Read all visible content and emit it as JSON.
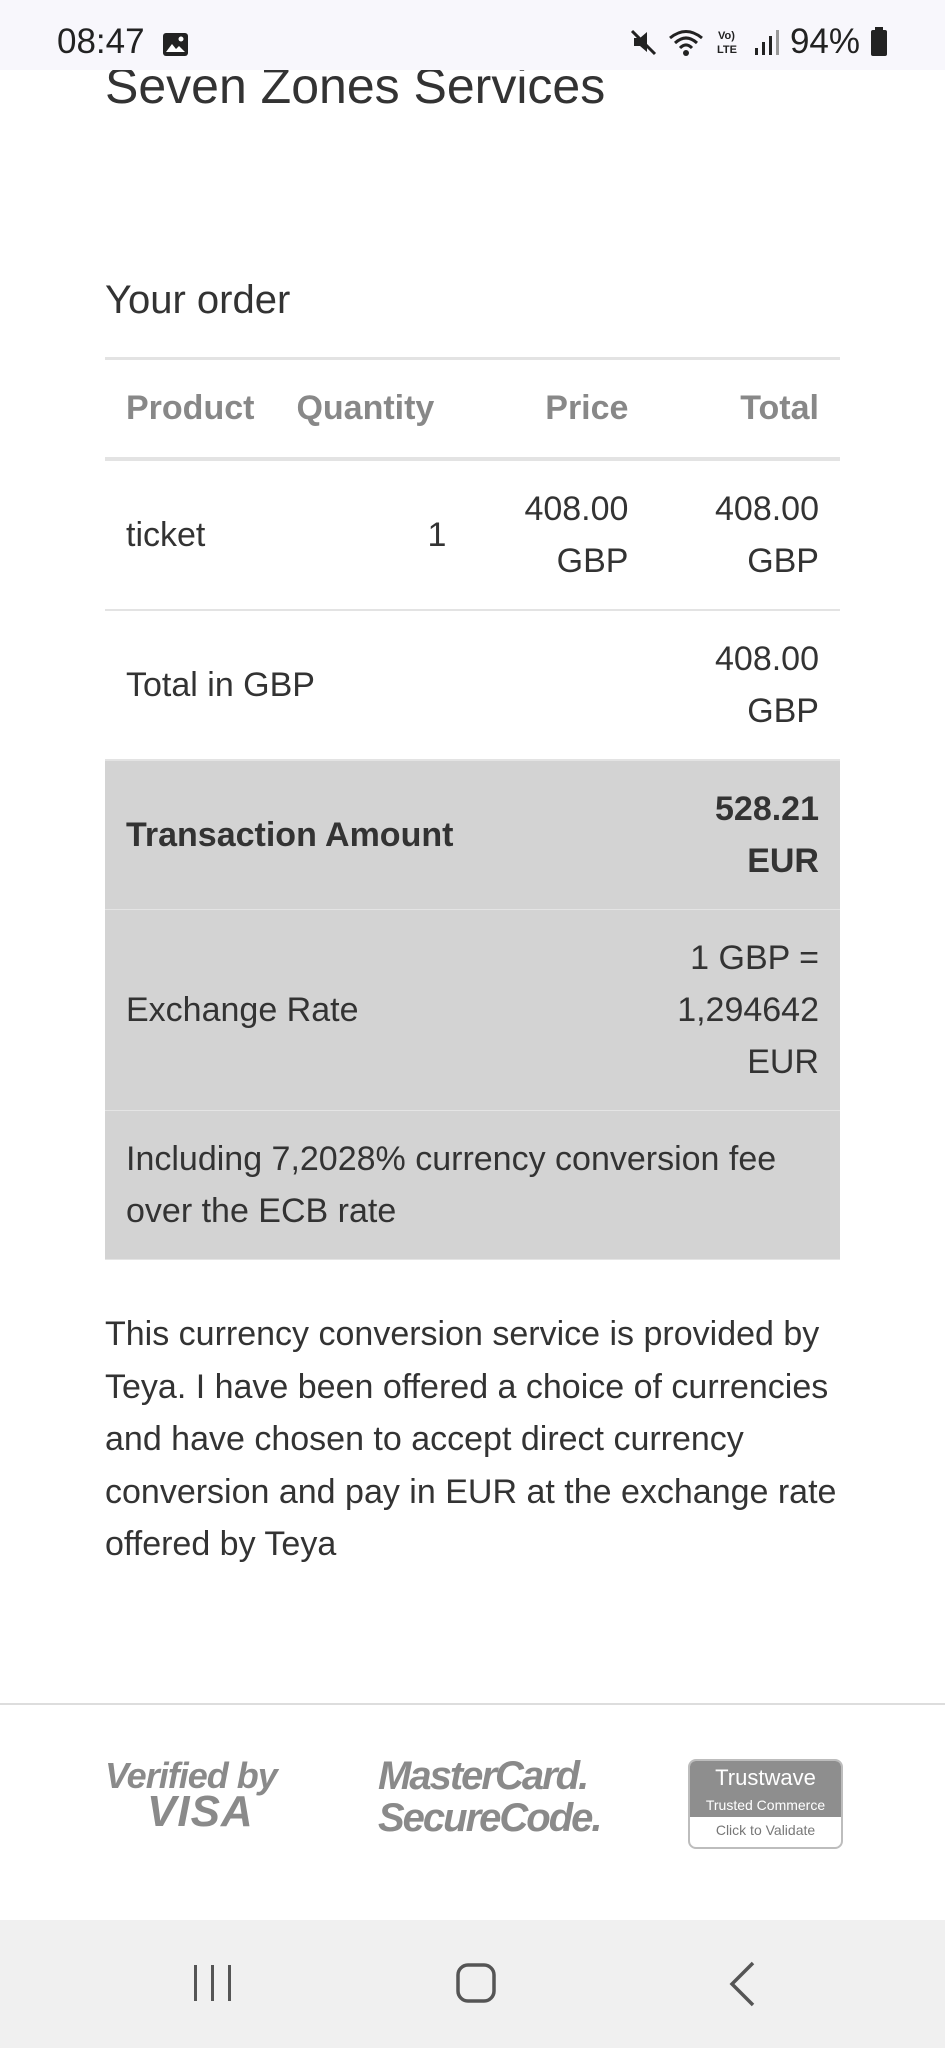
{
  "status_bar": {
    "time": "08:47",
    "battery": "94%",
    "icons": [
      "image-icon",
      "mute-icon",
      "wifi-icon",
      "volte-icon",
      "signal-icon",
      "battery-icon"
    ]
  },
  "merchant_name": "Seven Zones Services",
  "order": {
    "title": "Your order",
    "headers": [
      "Product",
      "Quantity",
      "Price",
      "Total"
    ],
    "rows": [
      {
        "product": "ticket",
        "quantity": "1",
        "price": "408.00 GBP",
        "total": "408.00 GBP"
      }
    ],
    "total_label": "Total in GBP",
    "total_value": "408.00 GBP"
  },
  "conversion": {
    "transaction_label": "Transaction Amount",
    "transaction_value": "528.21 EUR",
    "rate_label": "Exchange Rate",
    "rate_value": "1 GBP = 1,294642 EUR",
    "fee_note": "Including 7,2028% currency conversion fee over the ECB rate"
  },
  "disclaimer": "This currency conversion service is provided by Teya. I have been offered a choice of currencies and have chosen to accept direct currency conversion and pay in EUR at the exchange rate offered by Teya",
  "logos": {
    "visa_line1": "Verified by",
    "visa_line2": "VISA",
    "mastercard_line1": "MasterCard.",
    "mastercard_line2": "SecureCode.",
    "trustwave_line1": "Trustwave",
    "trustwave_line2": "Trusted Commerce",
    "trustwave_line3": "Click to Validate"
  },
  "colors": {
    "grey_row": "#d3d3d3",
    "border": "#e3e3e3",
    "header_text": "#888888"
  }
}
